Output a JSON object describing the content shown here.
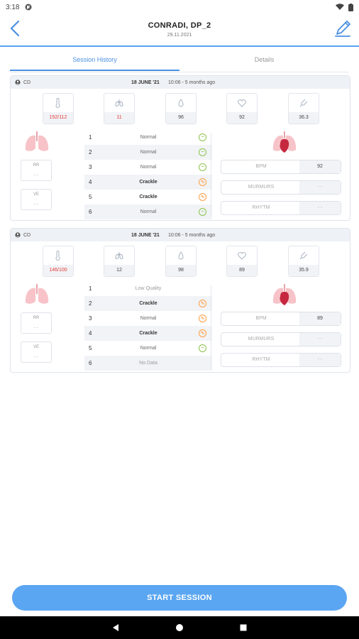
{
  "status_bar": {
    "time": "3:18"
  },
  "header": {
    "title": "CONRADI, DP_2",
    "subtitle": "29.11.2021"
  },
  "tabs": [
    {
      "label": "Session History",
      "active": true
    },
    {
      "label": "Details",
      "active": false
    }
  ],
  "sessions": [
    {
      "user": "CD",
      "date": "18 JUNE '21",
      "time": "10:06 - 5 months ago",
      "vitals": [
        {
          "icon": "thermometer-icon",
          "value": "152/112",
          "alert": true
        },
        {
          "icon": "lungs-icon",
          "value": "11",
          "alert": true
        },
        {
          "icon": "drop-icon",
          "value": "96",
          "alert": false
        },
        {
          "icon": "heart-icon",
          "value": "92",
          "alert": false
        },
        {
          "icon": "thermometer-icon",
          "value": "36.3",
          "alert": false
        }
      ],
      "rr": {
        "label": "RR",
        "value": "- -"
      },
      "ve": {
        "label": "VE",
        "value": "- -"
      },
      "auscultation": [
        {
          "num": "1",
          "status": "Normal",
          "type": "ok"
        },
        {
          "num": "2",
          "status": "Normal",
          "type": "ok"
        },
        {
          "num": "3",
          "status": "Normal",
          "type": "ok"
        },
        {
          "num": "4",
          "status": "Crackle",
          "type": "warn"
        },
        {
          "num": "5",
          "status": "Crackle",
          "type": "warn"
        },
        {
          "num": "6",
          "status": "Normal",
          "type": "ok"
        }
      ],
      "heart_fields": [
        {
          "label": "BPM",
          "value": "92"
        },
        {
          "label": "MURMURS",
          "value": "- -"
        },
        {
          "label": "RHYTM",
          "value": "- -"
        }
      ]
    },
    {
      "user": "CD",
      "date": "18 JUNE '21",
      "time": "10:06 - 5 months ago",
      "vitals": [
        {
          "icon": "thermometer-icon",
          "value": "146/100",
          "alert": true
        },
        {
          "icon": "lungs-icon",
          "value": "12",
          "alert": false
        },
        {
          "icon": "drop-icon",
          "value": "98",
          "alert": false
        },
        {
          "icon": "heart-icon",
          "value": "89",
          "alert": false
        },
        {
          "icon": "thermometer-icon",
          "value": "35.9",
          "alert": false
        }
      ],
      "rr": {
        "label": "RR",
        "value": "- -"
      },
      "ve": {
        "label": "VE",
        "value": "- -"
      },
      "auscultation": [
        {
          "num": "1",
          "status": "Low Quality",
          "type": "none"
        },
        {
          "num": "2",
          "status": "Crackle",
          "type": "warn"
        },
        {
          "num": "3",
          "status": "Normal",
          "type": "warn"
        },
        {
          "num": "4",
          "status": "Crackle",
          "type": "warn"
        },
        {
          "num": "5",
          "status": "Normal",
          "type": "ok"
        },
        {
          "num": "6",
          "status": "No Data",
          "type": "none"
        }
      ],
      "heart_fields": [
        {
          "label": "BPM",
          "value": "89"
        },
        {
          "label": "MURMURS",
          "value": "- -"
        },
        {
          "label": "RHYTM",
          "value": "- -"
        }
      ]
    }
  ],
  "start_button": {
    "label": "START SESSION"
  },
  "colors": {
    "accent": "#5aa6f2",
    "alert": "#e53935",
    "ok": "#8bc34a",
    "warn": "#ff9f43"
  }
}
